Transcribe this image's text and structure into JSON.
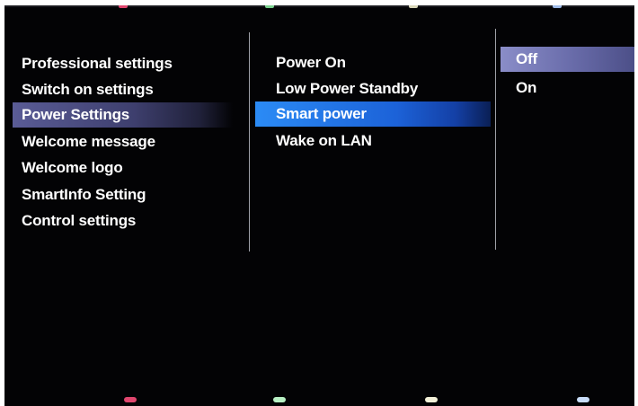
{
  "menu_level1": {
    "items": [
      {
        "label": "Professional settings"
      },
      {
        "label": "Switch on settings"
      },
      {
        "label": "Power Settings"
      },
      {
        "label": "Welcome message"
      },
      {
        "label": "Welcome logo"
      },
      {
        "label": "SmartInfo Setting"
      },
      {
        "label": "Control settings"
      }
    ],
    "selected_index": 2
  },
  "menu_level2": {
    "items": [
      {
        "label": "Power On"
      },
      {
        "label": "Low Power Standby"
      },
      {
        "label": "Smart power"
      },
      {
        "label": "Wake on LAN"
      }
    ],
    "focused_index": 2
  },
  "menu_level3": {
    "options": [
      {
        "label": "Off"
      },
      {
        "label": "On"
      }
    ],
    "selected_index": 0
  },
  "remote_color_keys": [
    {
      "name": "red",
      "color": "#e0466e"
    },
    {
      "name": "green",
      "color": "#b8f0c4"
    },
    {
      "name": "yellow",
      "color": "#f2f0d8"
    },
    {
      "name": "blue",
      "color": "#c8dcf8"
    }
  ]
}
